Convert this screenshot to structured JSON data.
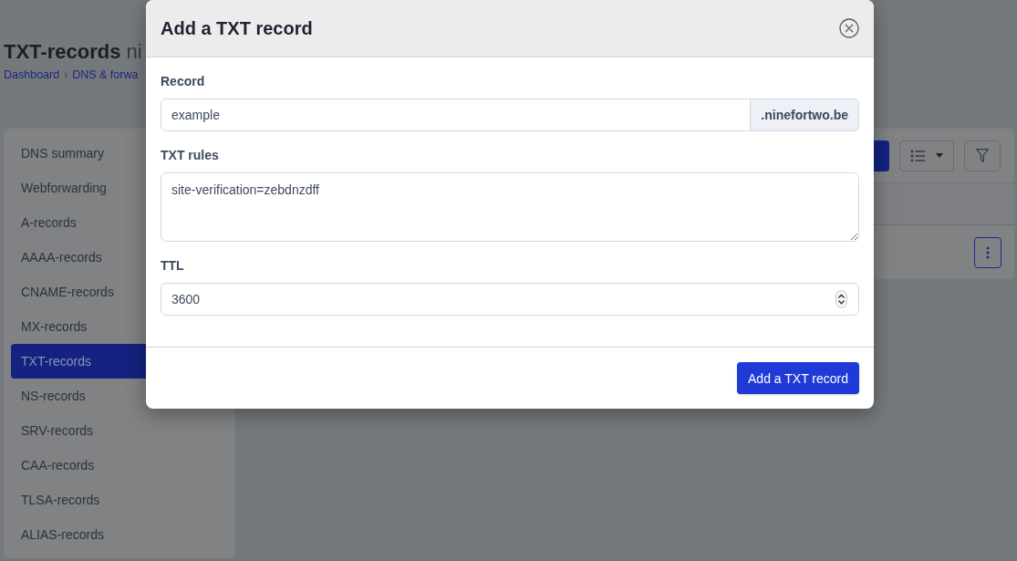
{
  "page": {
    "title": "**TXT-records** ni",
    "breadcrumb": {
      "items": [
        "Dashboard",
        "DNS & forwa"
      ],
      "separator": "›"
    }
  },
  "sidebar": {
    "items": [
      {
        "label": "DNS summary",
        "selected": false
      },
      {
        "label": "Webforwarding",
        "selected": false
      },
      {
        "label": "A-records",
        "selected": false
      },
      {
        "label": "AAAA-records",
        "selected": false
      },
      {
        "label": "CNAME-records",
        "selected": false
      },
      {
        "label": "MX-records",
        "selected": false
      },
      {
        "label": "TXT-records",
        "selected": true
      },
      {
        "label": "NS-records",
        "selected": false
      },
      {
        "label": "SRV-records",
        "selected": false
      },
      {
        "label": "CAA-records",
        "selected": false
      },
      {
        "label": "TLSA-records",
        "selected": false
      },
      {
        "label": "ALIAS-records",
        "selected": false
      }
    ]
  },
  "dialog": {
    "title": "Add a TXT record",
    "fields": [
      {
        "kind": "text",
        "label": "Record",
        "value": "example",
        "suffix": ".ninefortwo.be"
      },
      {
        "kind": "textarea",
        "label": "TXT rules",
        "value": "site-verification=zebdnzdff"
      },
      {
        "kind": "number",
        "label": "TTL",
        "value": "3600"
      }
    ],
    "submit": "Add a TXT record"
  }
}
